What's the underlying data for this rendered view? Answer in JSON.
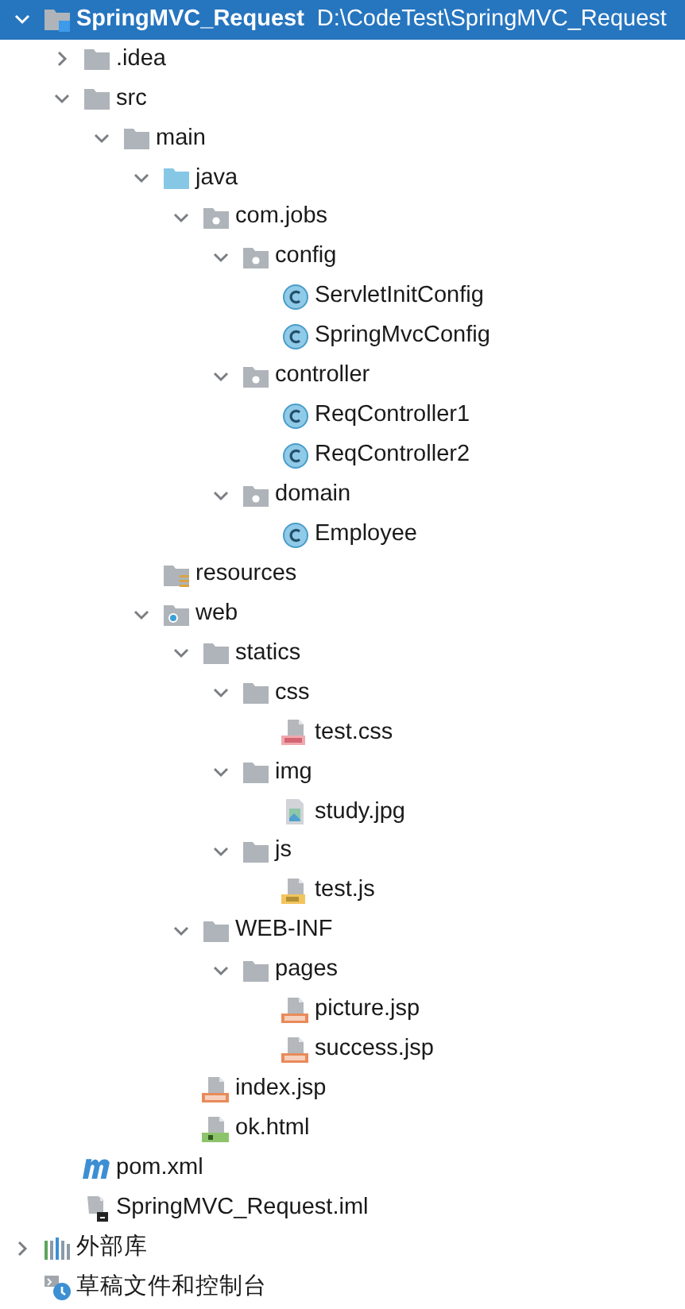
{
  "tree": [
    {
      "label": "SpringMVC_Request",
      "path": "D:\\CodeTest\\SpringMVC_Request",
      "kind": "module",
      "expanded": true,
      "selected": true,
      "children": [
        {
          "label": ".idea",
          "kind": "folder",
          "expanded": false,
          "selected": false
        },
        {
          "label": "src",
          "kind": "folder",
          "expanded": true,
          "selected": false,
          "children": [
            {
              "label": "main",
              "kind": "folder",
              "expanded": true,
              "selected": false,
              "children": [
                {
                  "label": "java",
                  "kind": "source",
                  "expanded": true,
                  "selected": false,
                  "children": [
                    {
                      "label": "com.jobs",
                      "kind": "package",
                      "expanded": true,
                      "selected": false,
                      "children": [
                        {
                          "label": "config",
                          "kind": "package",
                          "expanded": true,
                          "selected": false,
                          "children": [
                            {
                              "label": "ServletInitConfig",
                              "kind": "class",
                              "selected": false
                            },
                            {
                              "label": "SpringMvcConfig",
                              "kind": "class",
                              "selected": false
                            }
                          ]
                        },
                        {
                          "label": "controller",
                          "kind": "package",
                          "expanded": true,
                          "selected": false,
                          "children": [
                            {
                              "label": "ReqController1",
                              "kind": "class",
                              "selected": false
                            },
                            {
                              "label": "ReqController2",
                              "kind": "class",
                              "selected": false
                            }
                          ]
                        },
                        {
                          "label": "domain",
                          "kind": "package",
                          "expanded": true,
                          "selected": false,
                          "children": [
                            {
                              "label": "Employee",
                              "kind": "class",
                              "selected": false
                            }
                          ]
                        }
                      ]
                    }
                  ]
                },
                {
                  "label": "resources",
                  "kind": "resources",
                  "selected": false
                },
                {
                  "label": "web",
                  "kind": "web",
                  "expanded": true,
                  "selected": false,
                  "children": [
                    {
                      "label": "statics",
                      "kind": "folder",
                      "expanded": true,
                      "selected": false,
                      "children": [
                        {
                          "label": "css",
                          "kind": "folder",
                          "expanded": true,
                          "selected": false,
                          "children": [
                            {
                              "label": "test.css",
                              "kind": "css",
                              "selected": false
                            }
                          ]
                        },
                        {
                          "label": "img",
                          "kind": "folder",
                          "expanded": true,
                          "selected": false,
                          "children": [
                            {
                              "label": "study.jpg",
                              "kind": "image",
                              "selected": false
                            }
                          ]
                        },
                        {
                          "label": "js",
                          "kind": "folder",
                          "expanded": true,
                          "selected": false,
                          "children": [
                            {
                              "label": "test.js",
                              "kind": "js",
                              "selected": false
                            }
                          ]
                        }
                      ]
                    },
                    {
                      "label": "WEB-INF",
                      "kind": "folder",
                      "expanded": true,
                      "selected": false,
                      "children": [
                        {
                          "label": "pages",
                          "kind": "folder",
                          "expanded": true,
                          "selected": false,
                          "children": [
                            {
                              "label": "picture.jsp",
                              "kind": "jsp",
                              "selected": false
                            },
                            {
                              "label": "success.jsp",
                              "kind": "jsp",
                              "selected": false
                            }
                          ]
                        }
                      ]
                    },
                    {
                      "label": "index.jsp",
                      "kind": "jsp",
                      "selected": false
                    },
                    {
                      "label": "ok.html",
                      "kind": "html",
                      "selected": false
                    }
                  ]
                }
              ]
            }
          ]
        },
        {
          "label": "pom.xml",
          "kind": "maven",
          "selected": false
        },
        {
          "label": "SpringMVC_Request.iml",
          "kind": "iml",
          "selected": false
        }
      ]
    },
    {
      "label": "外部库",
      "kind": "libraries",
      "expanded": false,
      "selected": false
    },
    {
      "label": "草稿文件和控制台",
      "kind": "scratches",
      "selected": false
    }
  ]
}
